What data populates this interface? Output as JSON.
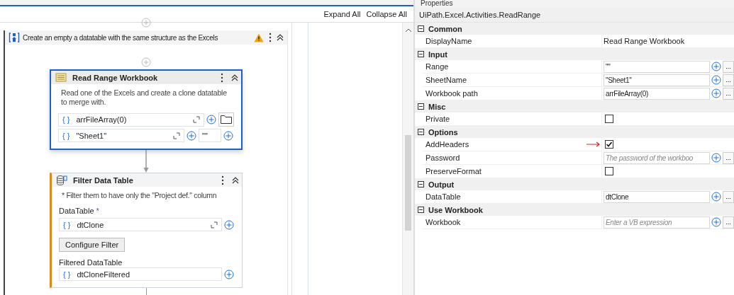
{
  "designer": {
    "toolbar": [
      "Expand All",
      "Collapse All"
    ],
    "sequence": {
      "title": "Create an empty a datatable with the same structure as the Excels",
      "warning": true,
      "read_range": {
        "title": "Read Range Workbook",
        "selected": true,
        "annotation": "Read one of the Excels and create a clone datatable to merge with.",
        "path": {
          "mark": "{ }",
          "value": "arrFileArray(0)"
        },
        "sheet": {
          "mark": "{ }",
          "value": "\"Sheet1\""
        },
        "range": {
          "value": "\"\""
        }
      },
      "filter": {
        "title": "Filter Data Table",
        "selected": false,
        "annotation": "* Filter them to have only the \"Project def.\" column",
        "input_label": "DataTable",
        "required_mark": "*",
        "input": {
          "mark": "{ }",
          "value": "dtClone"
        },
        "button": "Configure Filter",
        "output_label": "Filtered DataTable",
        "output": {
          "mark": "{ }",
          "value": "dtCloneFiltered"
        }
      }
    }
  },
  "properties": {
    "title": "Properties",
    "activity": "UiPath.Excel.Activities.ReadRange",
    "categories": [
      {
        "name": "Common",
        "expanded": true,
        "rows": [
          {
            "kind": "text",
            "label": "DisplayName",
            "value": "Read Range Workbook"
          }
        ]
      },
      {
        "name": "Input",
        "expanded": true,
        "rows": [
          {
            "kind": "field",
            "label": "Range",
            "value": "\"\"",
            "more": "..."
          },
          {
            "kind": "field",
            "label": "SheetName",
            "value": "\"Sheet1\"",
            "more": "..."
          },
          {
            "kind": "field",
            "label": "Workbook path",
            "value": "arrFileArray(0)",
            "more": "..."
          }
        ]
      },
      {
        "name": "Misc",
        "expanded": true,
        "rows": [
          {
            "kind": "checkbox",
            "label": "Private",
            "checked": false,
            "pointer": false
          }
        ]
      },
      {
        "name": "Options",
        "expanded": true,
        "rows": [
          {
            "kind": "checkbox",
            "label": "AddHeaders",
            "checked": true,
            "pointer": true
          },
          {
            "kind": "field",
            "label": "Password",
            "placeholder": "The password of the workboo",
            "more": "..."
          },
          {
            "kind": "checkbox",
            "label": "PreserveFormat",
            "checked": false,
            "pointer": false
          }
        ]
      },
      {
        "name": "Output",
        "expanded": true,
        "rows": [
          {
            "kind": "field",
            "label": "DataTable",
            "value": "dtClone",
            "more": "..."
          }
        ]
      },
      {
        "name": "Use Workbook",
        "expanded": true,
        "rows": [
          {
            "kind": "field",
            "label": "Workbook",
            "placeholder": "Enter a VB expression",
            "more": "..."
          }
        ]
      }
    ]
  }
}
